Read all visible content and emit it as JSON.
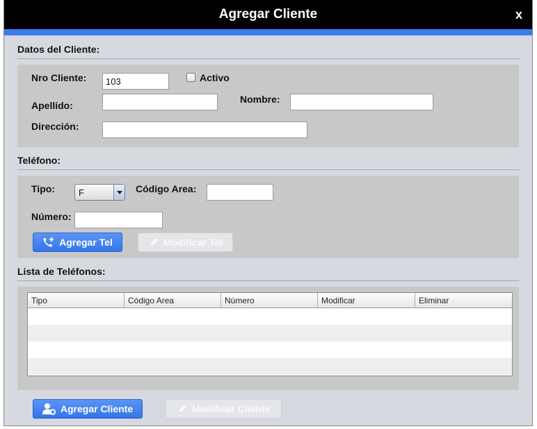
{
  "dialog": {
    "title": "Agregar Cliente",
    "close_label": "x",
    "accent_color": "#3b7bf0"
  },
  "cliente": {
    "section_title": "Datos del Cliente:",
    "nro_label": "Nro Cliente:",
    "nro_value": "103",
    "activo_label": "Activo",
    "activo_checked": false,
    "apellido_label": "Apellido:",
    "apellido_value": "",
    "nombre_label": "Nombre:",
    "nombre_value": "",
    "direccion_label": "Dirección:",
    "direccion_value": ""
  },
  "telefono": {
    "section_title": "Teléfono:",
    "tipo_label": "Tipo:",
    "tipo_value": "F",
    "codigo_label": "Código Area:",
    "codigo_value": "",
    "numero_label": "Número:",
    "numero_value": "",
    "agregar_tel_label": "Agregar Tel",
    "modificar_tel_label": "Modificar Tel",
    "agregar_tel_icon": "phone-add-icon",
    "modificar_tel_icon": "pencil-icon"
  },
  "lista": {
    "section_title": "Lista de Teléfonos:",
    "columns": [
      "Tipo",
      "Código Area",
      "Número",
      "Modificar",
      "Eliminar"
    ],
    "rows": []
  },
  "footer": {
    "agregar_cliente_label": "Agregar Cliente",
    "modificar_cliente_label": "Modificar Cliente",
    "agregar_cliente_icon": "user-add-icon",
    "modificar_cliente_icon": "pencil-icon"
  }
}
